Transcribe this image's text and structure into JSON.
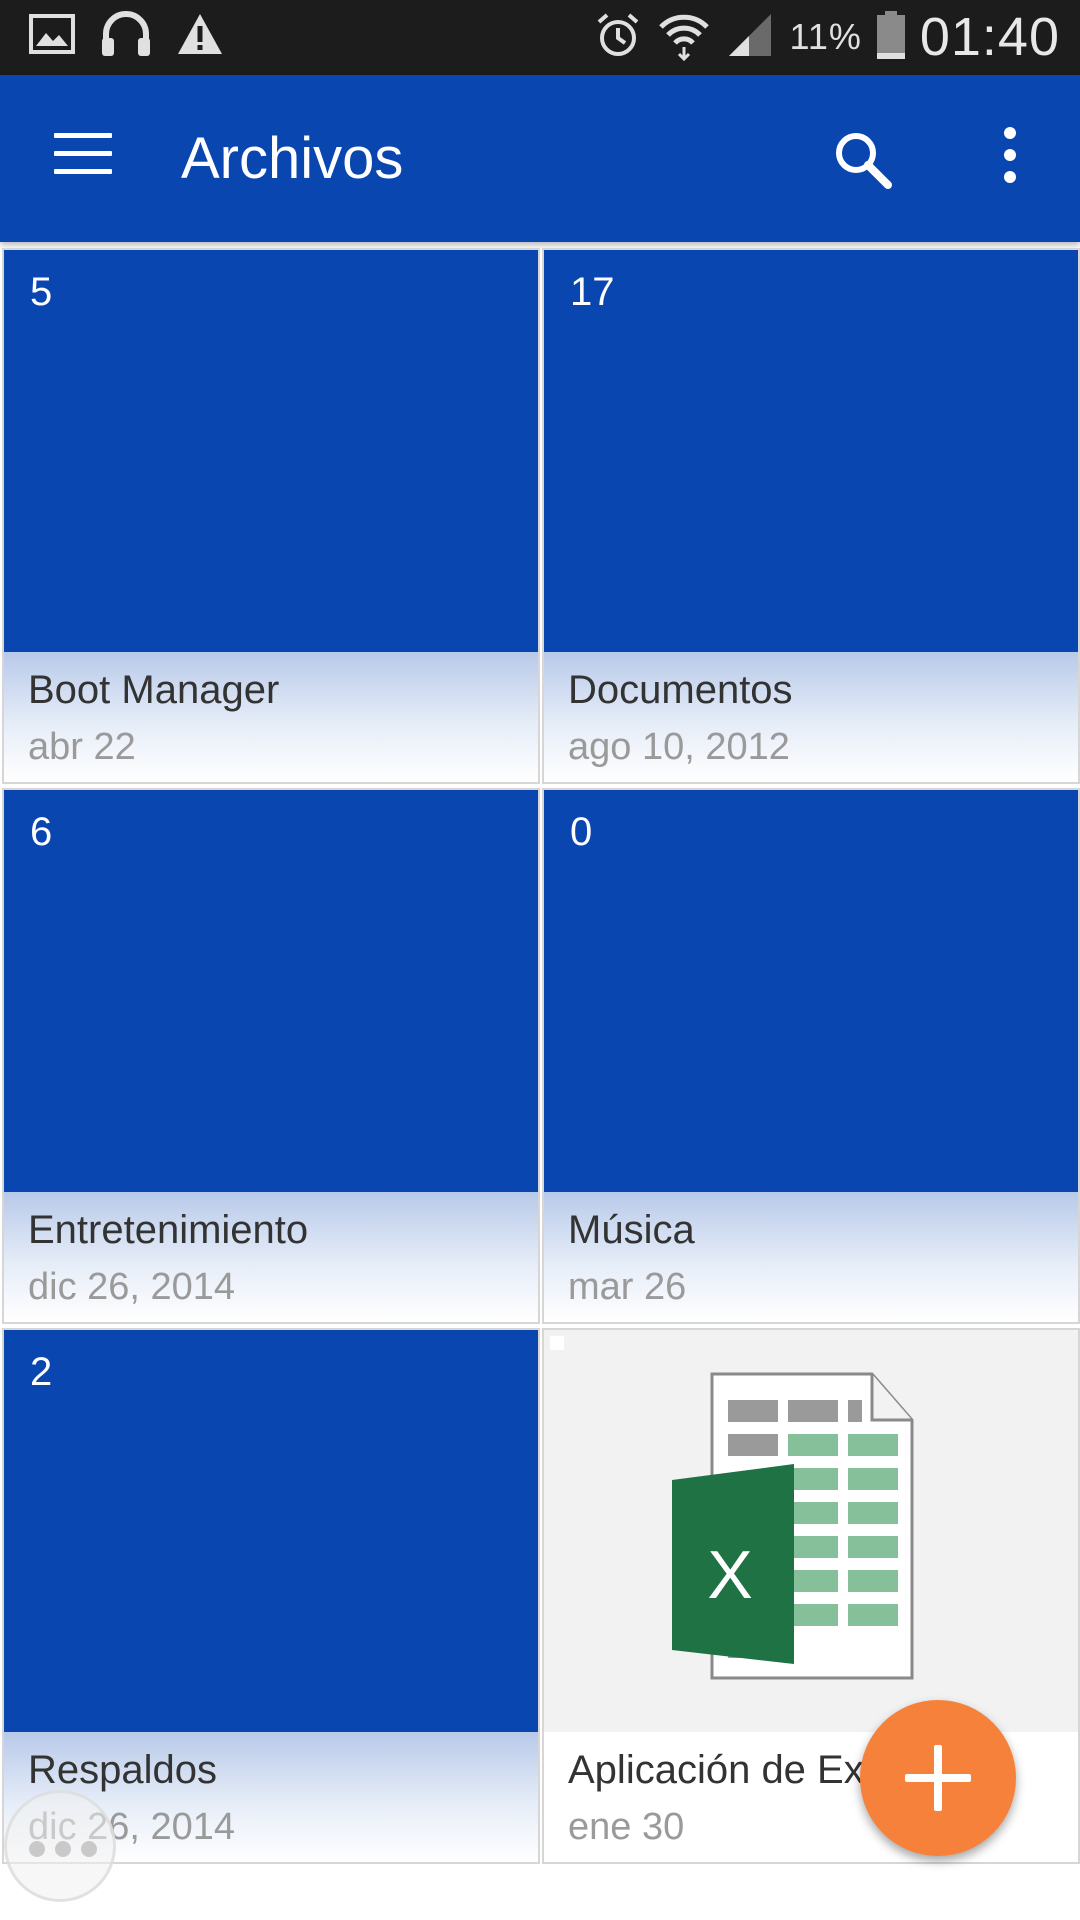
{
  "status_bar": {
    "battery_percent": "11%",
    "time": "01:40",
    "left_icons": [
      "image-icon",
      "headphones-icon",
      "warning-icon"
    ],
    "right_icons": [
      "alarm-icon",
      "wifi-icon",
      "signal-icon",
      "battery-icon"
    ]
  },
  "app_bar": {
    "title": "Archivos",
    "color": "#0a46b0",
    "icons": [
      "menu-icon",
      "search-icon",
      "more-vert-icon"
    ]
  },
  "tiles": [
    {
      "count": "5",
      "name": "Boot Manager",
      "date": "abr 22",
      "kind": "folder"
    },
    {
      "count": "17",
      "name": "Documentos",
      "date": "ago 10, 2012",
      "kind": "folder"
    },
    {
      "count": "6",
      "name": "Entretenimiento",
      "date": "dic 26, 2014",
      "kind": "folder"
    },
    {
      "count": "0",
      "name": "Música",
      "date": "mar 26",
      "kind": "folder"
    },
    {
      "count": "2",
      "name": "Respaldos",
      "date": "dic 26, 2014",
      "kind": "folder"
    },
    {
      "name": "Aplicación de Excel...",
      "date": "ene 30",
      "kind": "excel-file"
    }
  ],
  "fab": {
    "icon": "plus-icon",
    "color": "#f5813a"
  }
}
